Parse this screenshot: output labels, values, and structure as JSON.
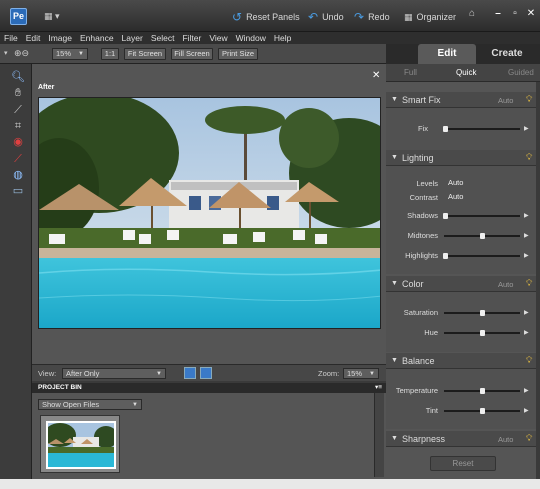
{
  "titlebar": {
    "reset_panels": "Reset Panels",
    "undo": "Undo",
    "redo": "Redo",
    "organizer": "Organizer"
  },
  "menu": [
    "File",
    "Edit",
    "Image",
    "Enhance",
    "Layer",
    "Select",
    "Filter",
    "View",
    "Window",
    "Help"
  ],
  "options": {
    "zoom": "15%",
    "btn_1to1": "1:1",
    "fit_screen": "Fit Screen",
    "fill_screen": "Fill Screen",
    "print_size": "Print Size"
  },
  "tabs": {
    "edit": "Edit",
    "create": "Create"
  },
  "doc": {
    "label": "After"
  },
  "viewbar": {
    "view_label": "View:",
    "view_value": "After Only",
    "zoom_label": "Zoom:",
    "zoom_value": "15%"
  },
  "bin": {
    "title": "PROJECT BIN",
    "filter": "Show Open Files"
  },
  "panel": {
    "subtabs": [
      "Full",
      "Quick",
      "Guided"
    ],
    "smartfix": {
      "title": "Smart Fix",
      "auto": "Auto",
      "fix": "Fix"
    },
    "lighting": {
      "title": "Lighting",
      "levels": "Levels",
      "levels_auto": "Auto",
      "contrast": "Contrast",
      "contrast_auto": "Auto",
      "shadows": "Shadows",
      "midtones": "Midtones",
      "highlights": "Highlights"
    },
    "color": {
      "title": "Color",
      "auto": "Auto",
      "saturation": "Saturation",
      "hue": "Hue"
    },
    "balance": {
      "title": "Balance",
      "temperature": "Temperature",
      "tint": "Tint"
    },
    "sharpness": {
      "title": "Sharpness",
      "auto": "Auto"
    },
    "reset": "Reset"
  }
}
